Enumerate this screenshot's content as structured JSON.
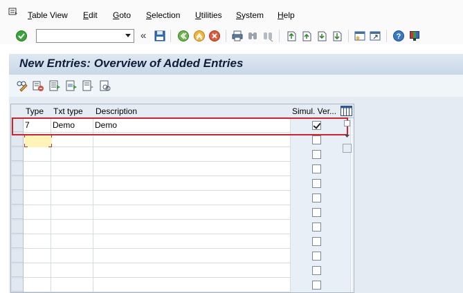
{
  "menubar": {
    "items": [
      {
        "label": "Table View",
        "mnemonic_index": 0
      },
      {
        "label": "Edit",
        "mnemonic_index": 0
      },
      {
        "label": "Goto",
        "mnemonic_index": 0
      },
      {
        "label": "Selection",
        "mnemonic_index": 0
      },
      {
        "label": "Utilities",
        "mnemonic_index": 0
      },
      {
        "label": "System",
        "mnemonic_index": 0
      },
      {
        "label": "Help",
        "mnemonic_index": 0
      }
    ]
  },
  "toolbar": {
    "command_field": {
      "value": "",
      "placeholder": ""
    },
    "icons": [
      "enter-icon",
      "save-icon",
      "back-icon",
      "exit-icon",
      "cancel-icon",
      "print-icon",
      "find-icon",
      "find-next-icon",
      "first-page-icon",
      "previous-page-icon",
      "next-page-icon",
      "last-page-icon",
      "create-session-icon",
      "shortcut-icon",
      "help-icon",
      "customize-layout-icon"
    ]
  },
  "title": "New Entries: Overview of Added Entries",
  "app_toolbar": {
    "icons": [
      "display-change-icon",
      "delete-icon",
      "select-all-icon",
      "select-block-icon",
      "deselect-all-icon",
      "variant-icon"
    ]
  },
  "table": {
    "columns": [
      {
        "label": "Type"
      },
      {
        "label": "Txt type"
      },
      {
        "label": "Description"
      },
      {
        "label": "Simul. Ver..."
      }
    ],
    "rows": [
      {
        "type": "7",
        "txt_type": "Demo",
        "description": "Demo",
        "simul_checked": true
      },
      {
        "type": "",
        "txt_type": "",
        "description": "",
        "simul_checked": false
      },
      {
        "type": "",
        "txt_type": "",
        "description": "",
        "simul_checked": false
      },
      {
        "type": "",
        "txt_type": "",
        "description": "",
        "simul_checked": false
      },
      {
        "type": "",
        "txt_type": "",
        "description": "",
        "simul_checked": false
      },
      {
        "type": "",
        "txt_type": "",
        "description": "",
        "simul_checked": false
      },
      {
        "type": "",
        "txt_type": "",
        "description": "",
        "simul_checked": false
      },
      {
        "type": "",
        "txt_type": "",
        "description": "",
        "simul_checked": false
      },
      {
        "type": "",
        "txt_type": "",
        "description": "",
        "simul_checked": false
      },
      {
        "type": "",
        "txt_type": "",
        "description": "",
        "simul_checked": false
      },
      {
        "type": "",
        "txt_type": "",
        "description": "",
        "simul_checked": false
      },
      {
        "type": "",
        "txt_type": "",
        "description": "",
        "simul_checked": false
      }
    ]
  },
  "colors": {
    "title_bar": "#c8d7e6",
    "highlight": "#d61f2d",
    "active_cell": "#fff3b8",
    "enter_icon": "#3aa43a"
  }
}
